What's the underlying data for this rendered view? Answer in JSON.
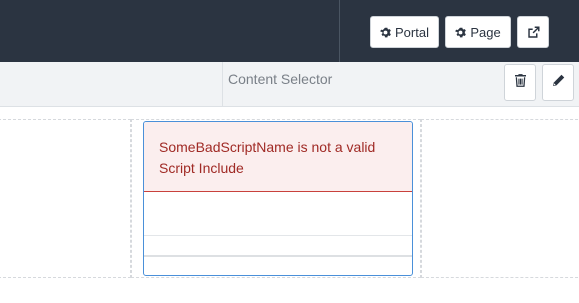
{
  "header": {
    "buttons": [
      {
        "label": "Portal",
        "icon": "gear-icon"
      },
      {
        "label": "Page",
        "icon": "gear-icon"
      },
      {
        "label": "",
        "icon": "external-link-icon"
      }
    ]
  },
  "toolbar": {
    "title": "Content Selector",
    "actions": [
      {
        "icon": "trash-icon"
      },
      {
        "icon": "pencil-icon"
      }
    ]
  },
  "widget": {
    "error_message": "SomeBadScriptName is not a valid Script Include"
  },
  "colors": {
    "header_bg": "#2b3441",
    "toolbar_bg": "#f1f3f5",
    "widget_border": "#4a90d9",
    "alert_bg": "#fbeeee",
    "alert_border": "#c9413c",
    "alert_text": "#a02a25"
  }
}
